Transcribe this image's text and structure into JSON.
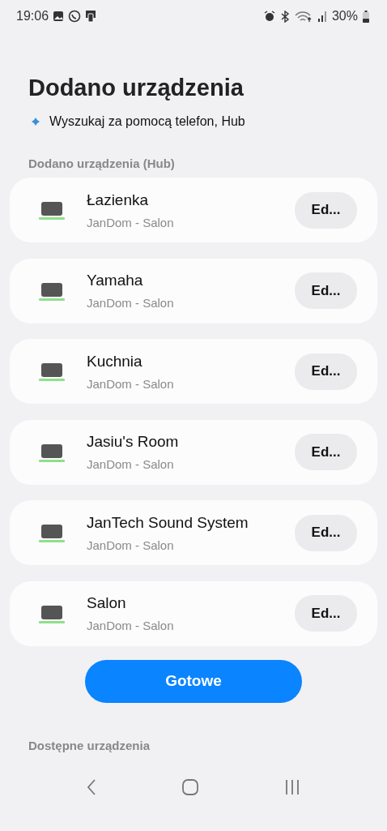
{
  "status_bar": {
    "time": "19:06",
    "battery": "30%"
  },
  "title": "Dodano urządzenia",
  "hint": "Wyszukaj za pomocą telefon, Hub",
  "section": "Dodano urządzenia (Hub)",
  "devices": [
    {
      "name": "Łazienka",
      "location": "JanDom - Salon",
      "action": "Ed..."
    },
    {
      "name": "Yamaha",
      "location": "JanDom - Salon",
      "action": "Ed..."
    },
    {
      "name": "Kuchnia",
      "location": "JanDom - Salon",
      "action": "Ed..."
    },
    {
      "name": "Jasiu's Room",
      "location": "JanDom - Salon",
      "action": "Ed..."
    },
    {
      "name": "JanTech Sound System",
      "location": "JanDom - Salon",
      "action": "Ed..."
    },
    {
      "name": "Salon",
      "location": "JanDom - Salon",
      "action": "Ed..."
    }
  ],
  "done_button": "Gotowe",
  "available_section": "Dostępne urządzenia"
}
